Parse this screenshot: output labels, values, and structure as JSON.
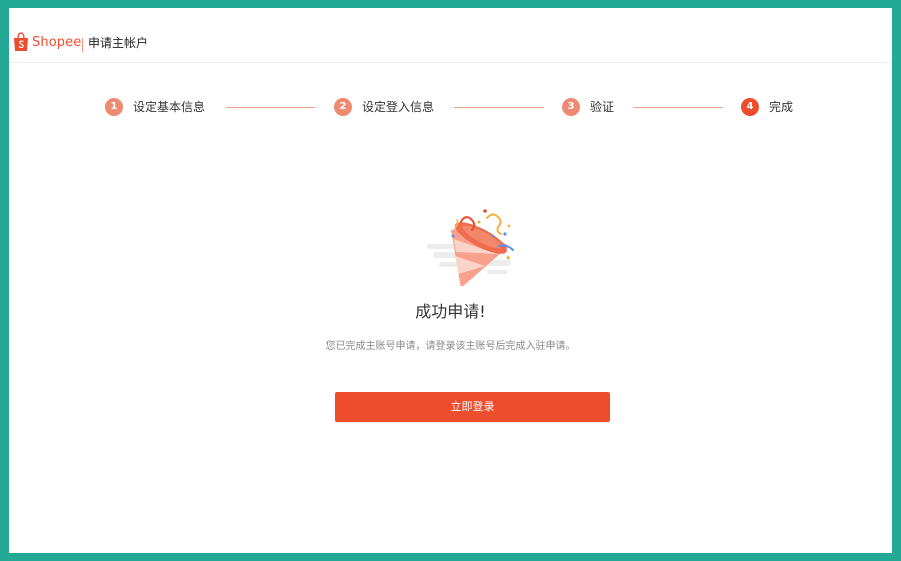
{
  "header": {
    "logo_text": "Shopee",
    "title": "申请主帐户"
  },
  "stepper": {
    "steps": [
      {
        "number": "1",
        "label": "设定基本信息",
        "state": "done"
      },
      {
        "number": "2",
        "label": "设定登入信息",
        "state": "done"
      },
      {
        "number": "3",
        "label": "验证",
        "state": "done"
      },
      {
        "number": "4",
        "label": "完成",
        "state": "active"
      }
    ]
  },
  "main": {
    "illustration_icon": "party-popper-icon",
    "title": "成功申请!",
    "description": "您已完成主账号申请，请登录该主账号后完成入驻申请。",
    "login_button_label": "立即登录"
  },
  "colors": {
    "accent": "#ee4d2d",
    "step_done": "#ef8a72",
    "frame_border": "#23a995"
  }
}
